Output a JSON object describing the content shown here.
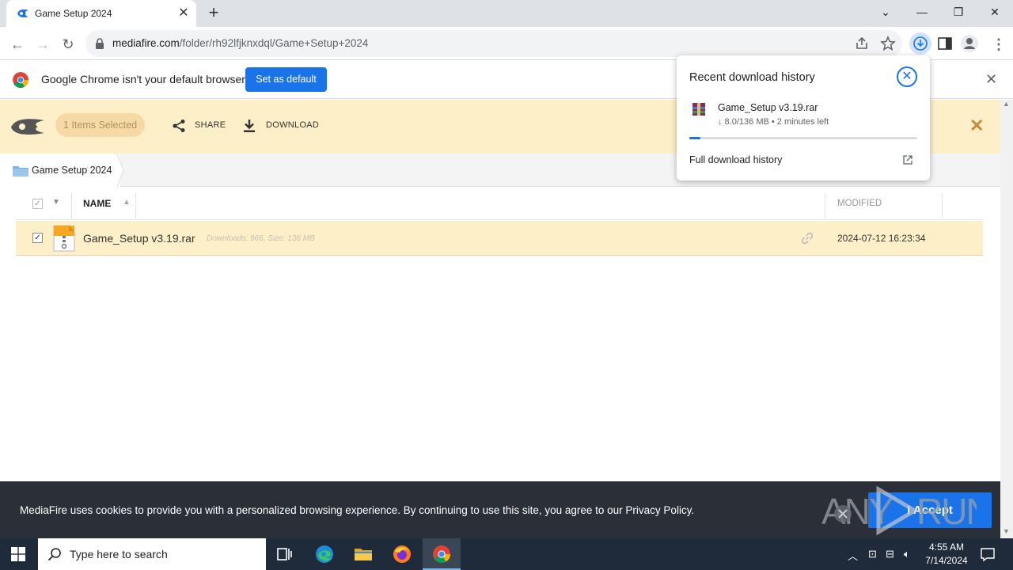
{
  "browser": {
    "tab_title": "Game Setup 2024",
    "url_domain": "mediafire.com",
    "url_path": "/folder/rh92lfjknxdql/Game+Setup+2024"
  },
  "infobar": {
    "message": "Google Chrome isn't your default browser",
    "button": "Set as default"
  },
  "mediafire": {
    "selection_count": "1 Items Selected",
    "share_label": "SHARE",
    "download_label": "DOWNLOAD",
    "breadcrumb": "Game Setup 2024",
    "columns": {
      "name": "NAME",
      "modified": "MODIFIED"
    },
    "rows": [
      {
        "name": "Game_Setup v3.19.rar",
        "meta": "Downloads: 966, Size: 136 MB",
        "modified": "2024-07-12 16:23:34"
      }
    ]
  },
  "download_popup": {
    "title": "Recent download history",
    "file": "Game_Setup v3.19.rar",
    "status": "↓ 8.0/136 MB • 2 minutes left",
    "progress": 0.05,
    "full_history": "Full download history"
  },
  "cookie": {
    "text": "MediaFire uses cookies to provide you with a personalized browsing experience. By continuing to use this site, you agree to our Privacy Policy.",
    "accept": "I Accept"
  },
  "watermark": "ANY RUN",
  "taskbar": {
    "search_placeholder": "Type here to search",
    "time": "4:55 AM",
    "date": "7/14/2024"
  },
  "colors": {
    "accent": "#1a73e8",
    "selection_bar": "#fdefc8",
    "cookie_bg": "#2b2f38",
    "taskbar_bg": "#1f2a3a"
  }
}
